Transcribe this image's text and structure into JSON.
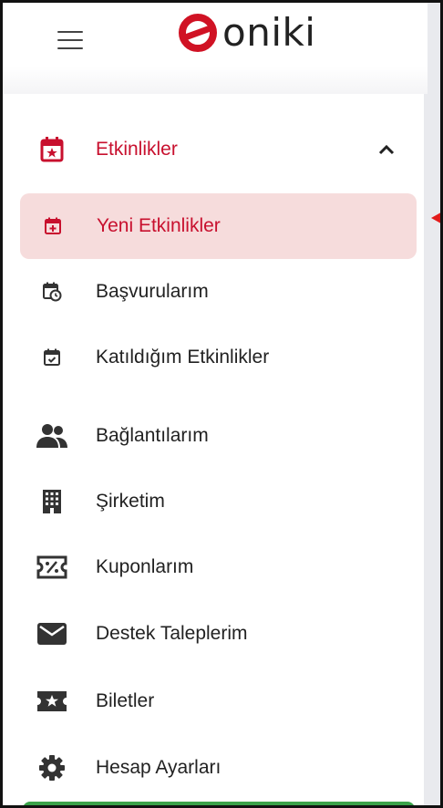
{
  "app": {
    "logo_text": "oniki"
  },
  "colors": {
    "brand_red": "#c8102e",
    "active_bg": "#f6dcdc",
    "icon_dark": "#333333",
    "pointer_red": "#e21b1b",
    "footer_green": "#3aa34a"
  },
  "menu": {
    "items": [
      {
        "label": "Etkinlikler",
        "icon": "calendar-star-icon"
      },
      {
        "label": "Yeni Etkinlikler",
        "icon": "calendar-plus-icon"
      },
      {
        "label": "Başvurularım",
        "icon": "calendar-clock-icon"
      },
      {
        "label": "Katıldığım Etkinlikler",
        "icon": "calendar-check-icon"
      },
      {
        "label": "Bağlantılarım",
        "icon": "people-icon"
      },
      {
        "label": "Şirketim",
        "icon": "building-icon"
      },
      {
        "label": "Kuponlarım",
        "icon": "coupon-icon"
      },
      {
        "label": "Destek Taleplerim",
        "icon": "envelope-icon"
      },
      {
        "label": "Biletler",
        "icon": "ticket-star-icon"
      },
      {
        "label": "Hesap Ayarları",
        "icon": "gear-icon"
      }
    ]
  }
}
